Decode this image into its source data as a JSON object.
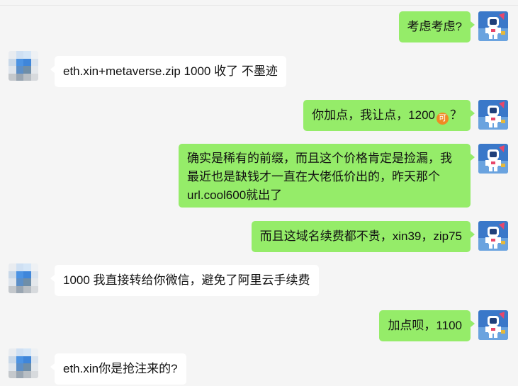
{
  "messages": [
    {
      "side": "right",
      "text": "考虑考虑?"
    },
    {
      "side": "left",
      "text": "eth.xin+metaverse.zip 1000 收了 不墨迹"
    },
    {
      "side": "right",
      "text_before": "你加点，我让点，1200",
      "emoji": "可",
      "text_after": "？"
    },
    {
      "side": "right",
      "line1": "确实是稀有的前缀，而且这个价格肯定是捡漏，我",
      "line2": "最近也是缺钱才一直在大佬低价出的，昨天那个",
      "line3": "url.cool600就出了"
    },
    {
      "side": "right",
      "text": "而且这域名续费都不贵，xin39，zip75"
    },
    {
      "side": "left",
      "text": "1000 我直接转给你微信，避免了阿里云手续费"
    },
    {
      "side": "right",
      "text": "加点呗，1100"
    },
    {
      "side": "left",
      "text": "eth.xin你是抢注来的?"
    }
  ],
  "colors": {
    "my_bubble": "#95ec69",
    "their_bubble": "#ffffff",
    "background": "#f5f5f5",
    "emoji": "#f08a24"
  },
  "icons": {
    "my_avatar": "astronaut-avatar-icon",
    "their_avatar": "pixelated-avatar-icon"
  }
}
